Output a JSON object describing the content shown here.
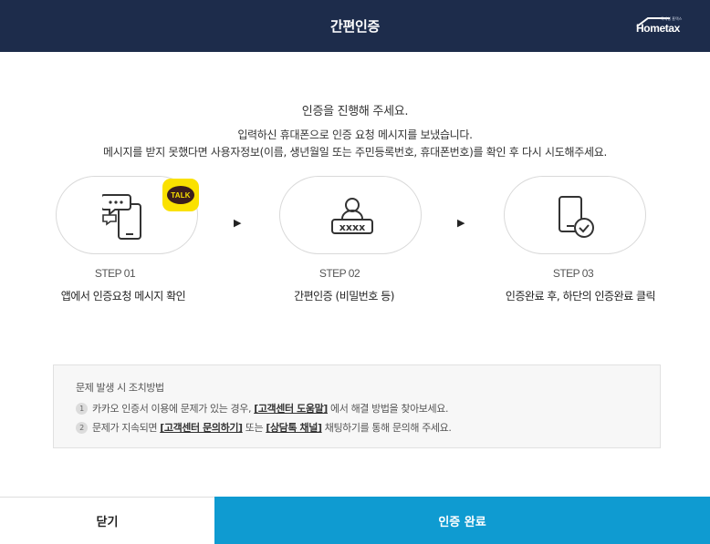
{
  "header": {
    "title": "간편인증",
    "logo_text": "Hometax",
    "logo_subtext": "국세청 홈택스"
  },
  "intro": {
    "title": "인증을 진행해 주세요.",
    "line1": "입력하신 휴대폰으로 인증 요청 메시지를 보냈습니다.",
    "line2": "메시지를 받지 못했다면 사용자정보(이름, 생년월일 또는 주민등록번호, 휴대폰번호)를 확인 후 다시 시도해주세요."
  },
  "steps": [
    {
      "label": "STEP 01",
      "desc": "앱에서 인증요청 메시지 확인",
      "icon": "phone-message-icon"
    },
    {
      "label": "STEP 02",
      "desc": "간편인증 (비밀번호 등)",
      "icon": "user-password-icon"
    },
    {
      "label": "STEP 03",
      "desc": "인증완료 후, 하단의 인증완료 클릭",
      "icon": "phone-check-icon"
    }
  ],
  "talk_badge": "TALK",
  "arrow_glyph": "▶",
  "help": {
    "title": "문제 발생 시 조치방법",
    "items": [
      {
        "num": "1",
        "pre": "카카오 인증서 이용에 문제가 있는 경우, ",
        "link1": "[고객센터 도움말]",
        "mid": " 에서 해결 방법을 찾아보세요.",
        "link2": "",
        "post": ""
      },
      {
        "num": "2",
        "pre": "문제가 지속되면 ",
        "link1": "[고객센터 문의하기]",
        "mid": " 또는 ",
        "link2": "[상담톡 채널]",
        "post": " 채팅하기를 통해 문의해 주세요."
      }
    ]
  },
  "footer": {
    "close_label": "닫기",
    "done_label": "인증 완료"
  },
  "colors": {
    "header_bg": "#1d2c4b",
    "accent": "#0f9bd1",
    "kakao_yellow": "#fae100"
  }
}
